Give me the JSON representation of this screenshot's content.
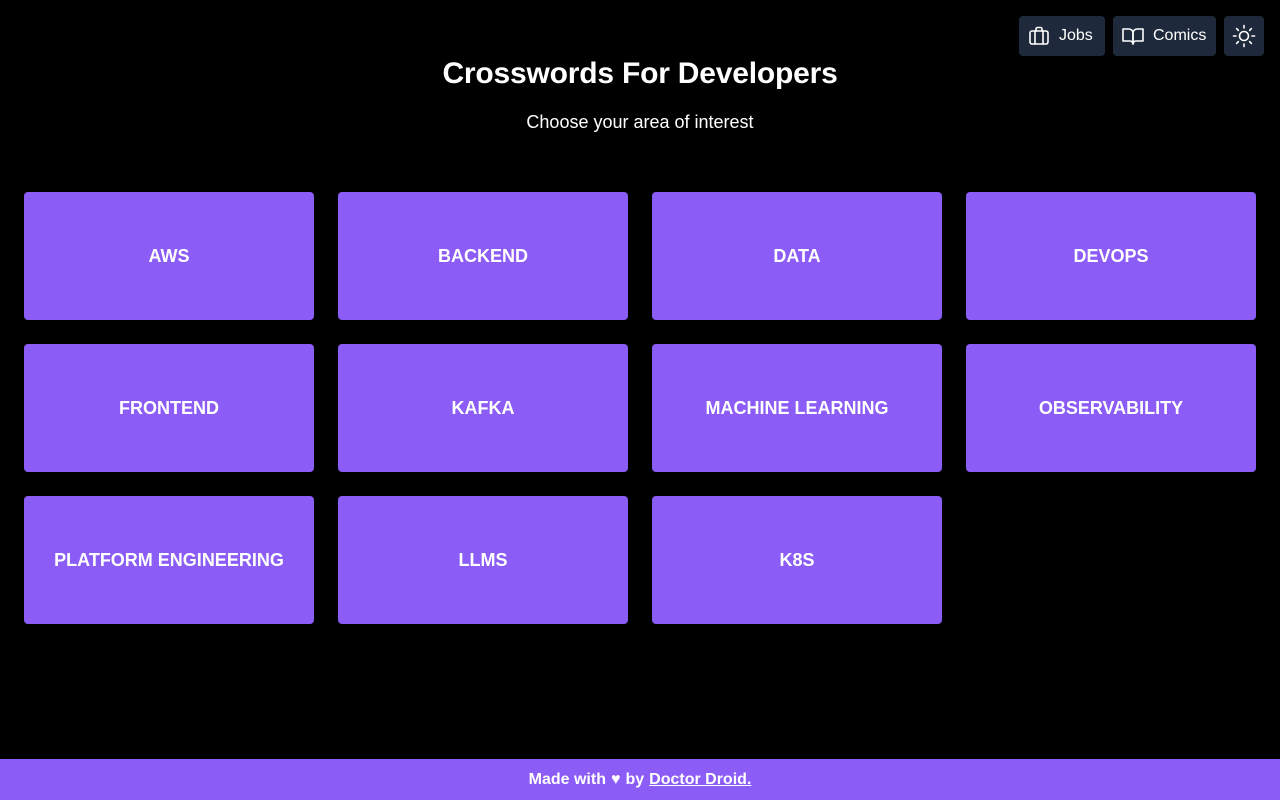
{
  "nav": {
    "jobs_label": "Jobs",
    "jobs_icon": "briefcase-icon",
    "comics_label": "Comics",
    "comics_icon": "book-open-icon",
    "theme_icon": "sun-icon"
  },
  "header": {
    "title": "Crosswords For Developers",
    "subtitle": "Choose your area of interest"
  },
  "topics": [
    "AWS",
    "BACKEND",
    "DATA",
    "DEVOPS",
    "FRONTEND",
    "KAFKA",
    "MACHINE LEARNING",
    "OBSERVABILITY",
    "PLATFORM ENGINEERING",
    "LLMS",
    "K8S"
  ],
  "footer": {
    "prefix": "Made with",
    "heart": "♥",
    "by": "by",
    "link_label": "Doctor Droid."
  },
  "colors": {
    "background": "#000000",
    "accent": "#8b5cf6",
    "nav_button": "#1e293b",
    "text": "#ffffff"
  }
}
